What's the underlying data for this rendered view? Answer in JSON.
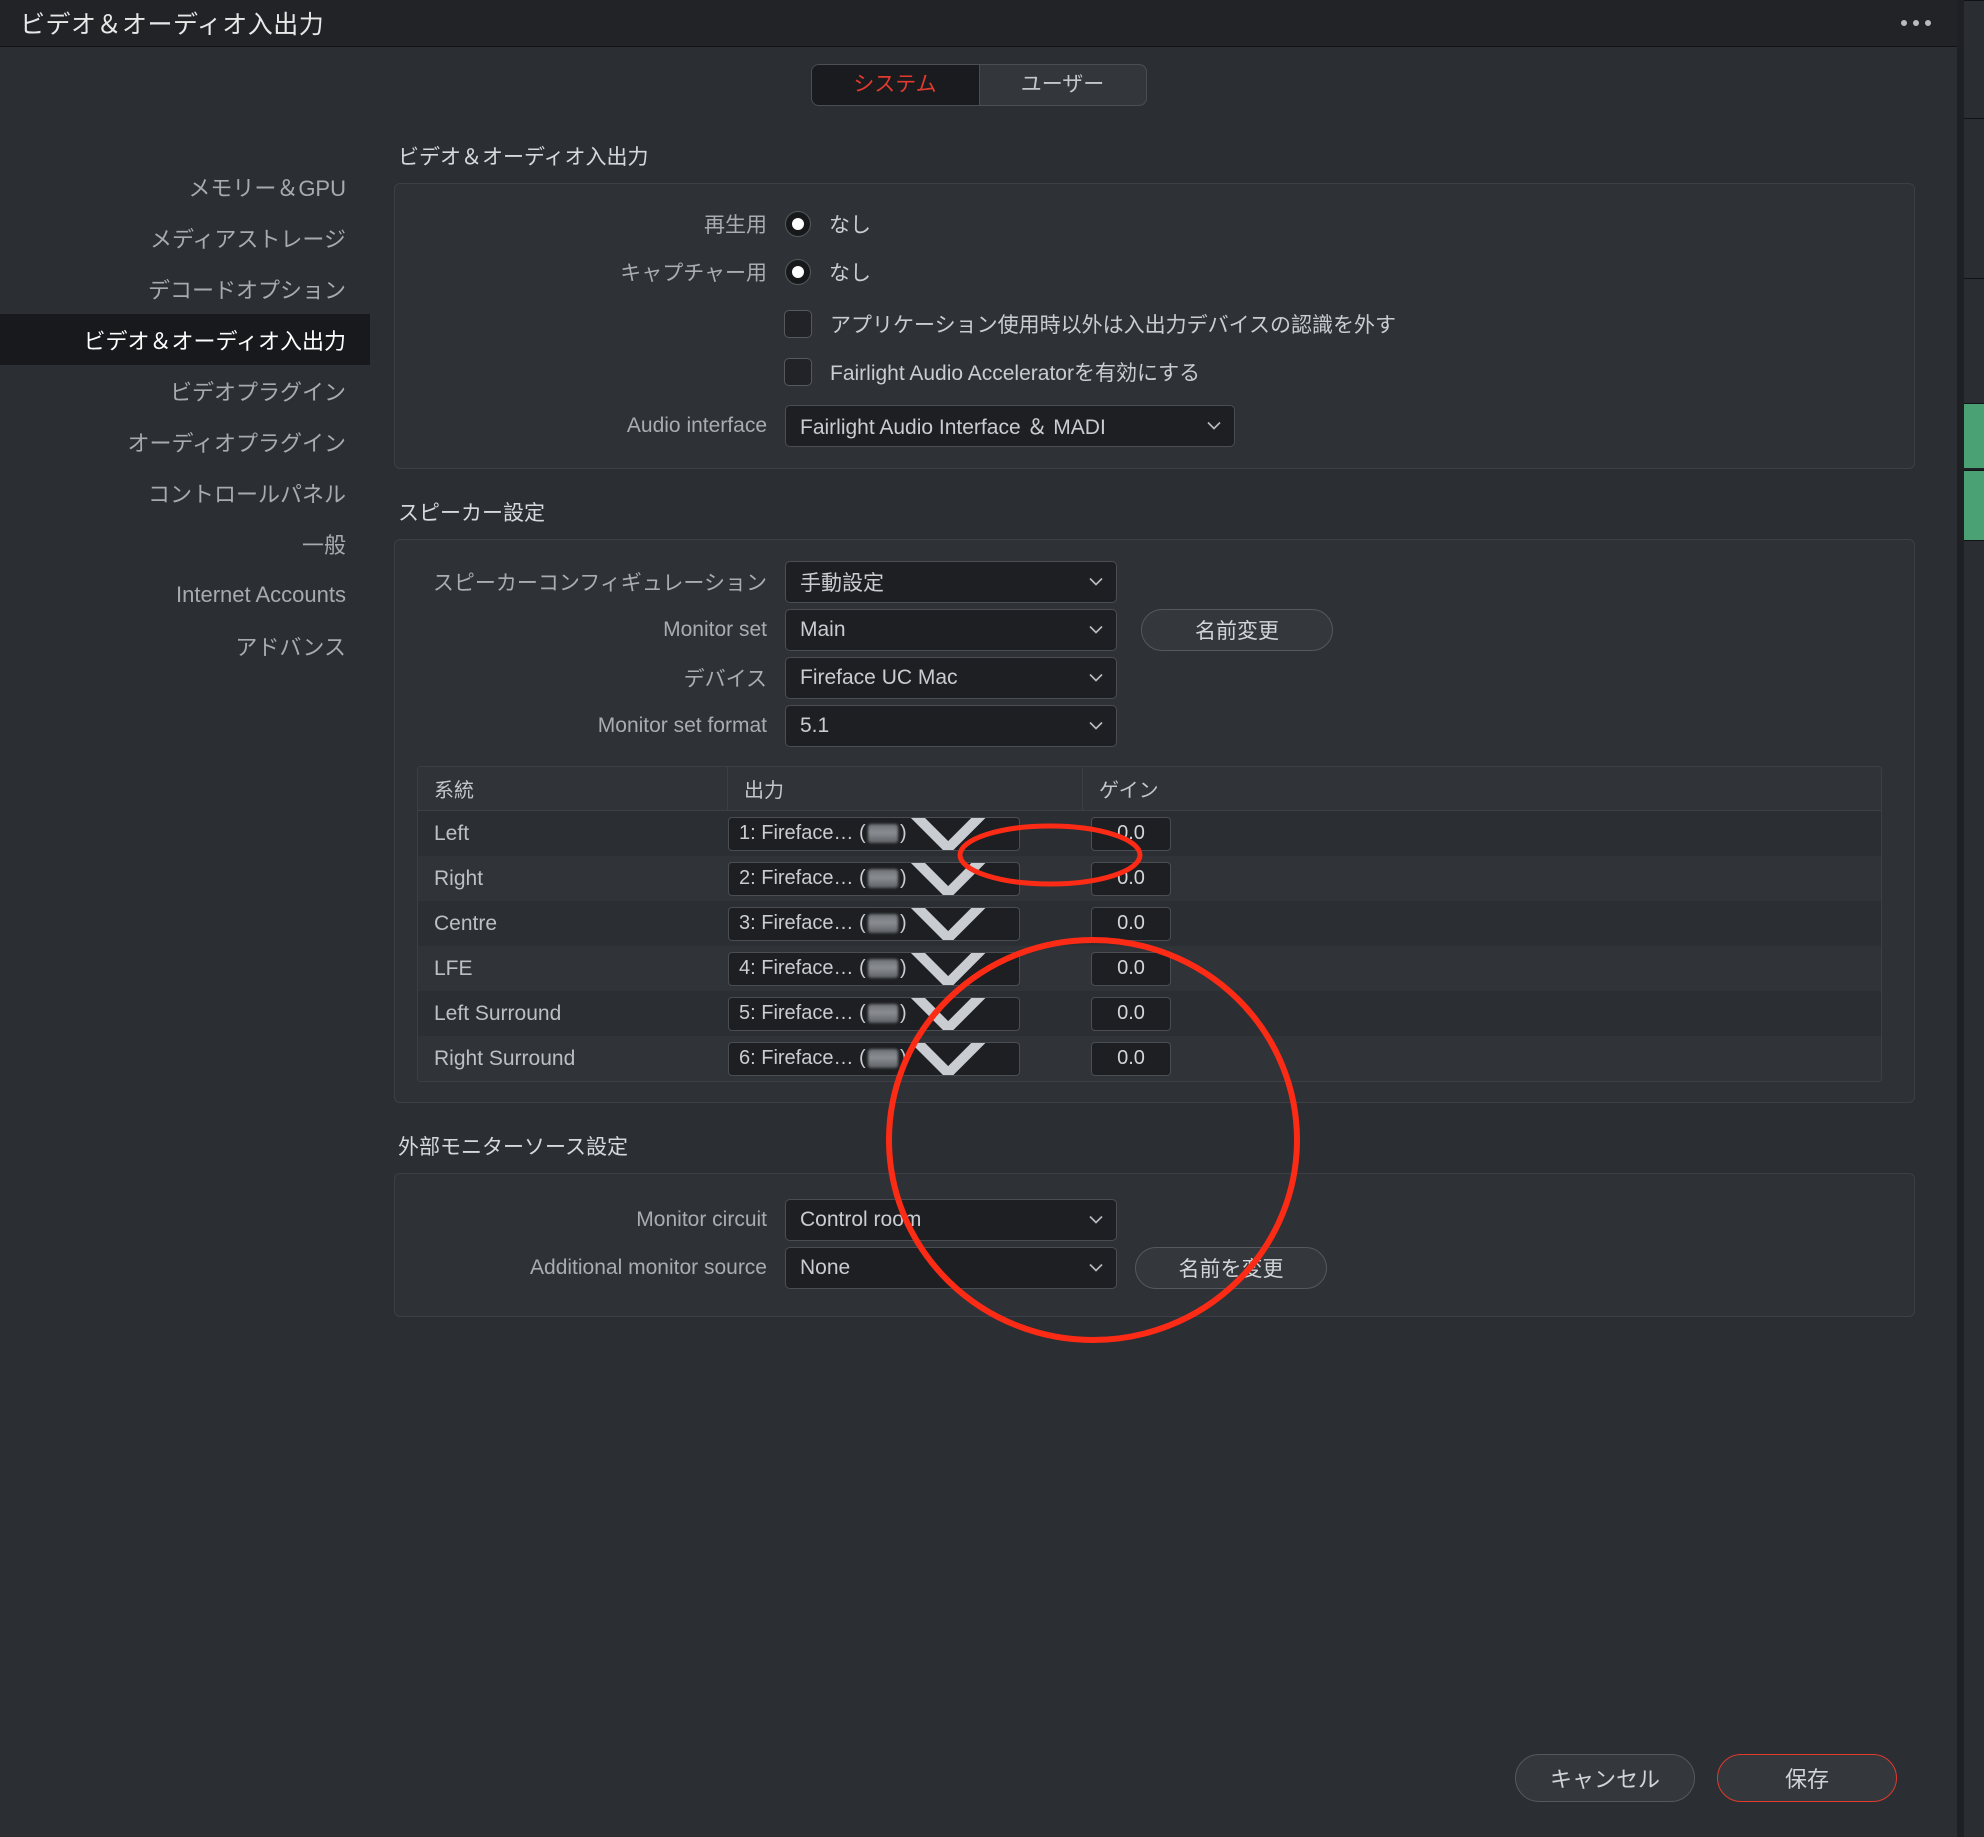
{
  "window": {
    "title": "ビデオ＆オーディオ入出力",
    "menu_icon": "ellipsis-icon"
  },
  "tabs": {
    "system": "システム",
    "user": "ユーザー",
    "active": "システム"
  },
  "sidebar": {
    "items": [
      {
        "label": "メモリー＆GPU",
        "active": false
      },
      {
        "label": "メディアストレージ",
        "active": false
      },
      {
        "label": "デコードオプション",
        "active": false
      },
      {
        "label": "ビデオ＆オーディオ入出力",
        "active": true
      },
      {
        "label": "ビデオプラグイン",
        "active": false
      },
      {
        "label": "オーディオプラグイン",
        "active": false
      },
      {
        "label": "コントロールパネル",
        "active": false
      },
      {
        "label": "一般",
        "active": false
      },
      {
        "label": "Internet Accounts",
        "active": false
      },
      {
        "label": "アドバンス",
        "active": false
      }
    ]
  },
  "video_audio_io": {
    "section_title": "ビデオ＆オーディオ入出力",
    "playback": {
      "label": "再生用",
      "value": "なし",
      "selected": true
    },
    "capture": {
      "label": "キャプチャー用",
      "value": "なし",
      "selected": true
    },
    "release_devices": {
      "label": "アプリケーション使用時以外は入出力デバイスの認識を外す",
      "checked": false
    },
    "fairlight_accelerator": {
      "label": "Fairlight Audio Acceleratorを有効にする",
      "checked": false
    },
    "audio_interface": {
      "label": "Audio interface",
      "value": "Fairlight Audio Interface ＆ MADI"
    }
  },
  "speaker_setup": {
    "section_title": "スピーカー設定",
    "speaker_configuration": {
      "label": "スピーカーコンフィギュレーション",
      "value": "手動設定"
    },
    "monitor_set": {
      "label": "Monitor set",
      "value": "Main",
      "rename_button": "名前変更"
    },
    "device": {
      "label": "デバイス",
      "value": "Fireface UC Mac"
    },
    "monitor_set_format": {
      "label": "Monitor set format",
      "value": "5.1",
      "highlighted": true
    },
    "table": {
      "headers": [
        "系統",
        "出力",
        "ゲイン"
      ],
      "rows": [
        {
          "channel": "Left",
          "output_prefix": "1: Fireface… (",
          "output_suffix": ")",
          "gain": "0.0"
        },
        {
          "channel": "Right",
          "output_prefix": "2: Fireface… (",
          "output_suffix": ")",
          "gain": "0.0"
        },
        {
          "channel": "Centre",
          "output_prefix": "3: Fireface… (",
          "output_suffix": ")",
          "gain": "0.0"
        },
        {
          "channel": "LFE",
          "output_prefix": "4: Fireface… (",
          "output_suffix": ")",
          "gain": "0.0"
        },
        {
          "channel": "Left Surround",
          "output_prefix": "5: Fireface… (",
          "output_suffix": ")",
          "gain": "0.0"
        },
        {
          "channel": "Right Surround",
          "output_prefix": "6: Fireface… (",
          "output_suffix": ")",
          "gain": "0.0"
        }
      ]
    }
  },
  "external_monitor": {
    "section_title": "外部モニターソース設定",
    "monitor_circuit": {
      "label": "Monitor circuit",
      "value": "Control room"
    },
    "additional_monitor_source": {
      "label": "Additional monitor source",
      "value": "None",
      "rename_button": "名前を変更"
    }
  },
  "footer": {
    "cancel": "キャンセル",
    "save": "保存"
  },
  "colors": {
    "accent_red": "#e23a2e",
    "annotation_red": "#fc2b16",
    "panel_bg": "#2e3135",
    "window_bg": "#2b2e33"
  }
}
